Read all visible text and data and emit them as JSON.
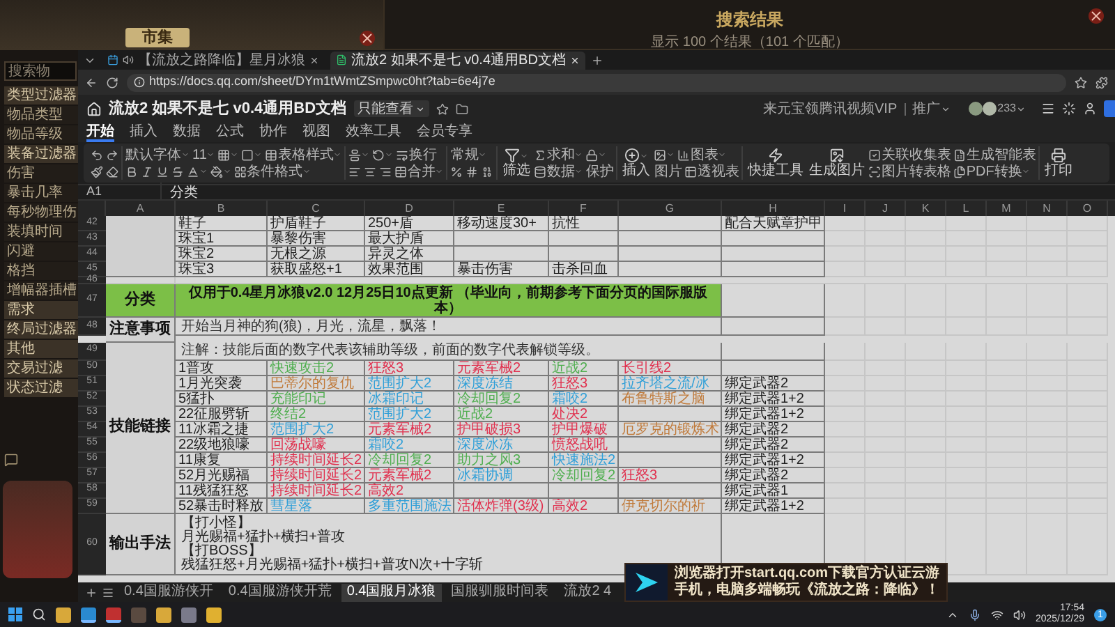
{
  "game": {
    "market": {
      "title": "市集"
    },
    "sidebar": {
      "search_placeholder": "搜索物",
      "filters": [
        {
          "label": "类型过滤器",
          "kind": "header"
        },
        {
          "label": "物品类型",
          "kind": "option"
        },
        {
          "label": "物品等级",
          "kind": "option"
        },
        {
          "label": "装备过滤器",
          "kind": "header"
        },
        {
          "label": "伤害",
          "kind": "option"
        },
        {
          "label": "暴击几率",
          "kind": "option"
        },
        {
          "label": "每秒物理伤",
          "kind": "option"
        },
        {
          "label": "装填时间",
          "kind": "option"
        },
        {
          "label": "闪避",
          "kind": "option"
        },
        {
          "label": "格挡",
          "kind": "option"
        },
        {
          "label": "增幅器插槽",
          "kind": "option"
        },
        {
          "label": "需求",
          "kind": "header"
        },
        {
          "label": "终局过滤器",
          "kind": "header"
        },
        {
          "label": "其他",
          "kind": "header"
        },
        {
          "label": "交易过滤",
          "kind": "header"
        },
        {
          "label": "状态过滤",
          "kind": "header"
        }
      ]
    },
    "results": {
      "title": "搜索结果",
      "summary": "显示 100 个结果（101 个匹配）"
    }
  },
  "browser": {
    "tabs": [
      {
        "label": "【流放之路降临】星月冰狼",
        "selected": false
      },
      {
        "label": "流放2 如果不是七 v0.4通用BD文档",
        "selected": true
      }
    ],
    "url": "https://docs.qq.com/sheet/DYm1tWmtZSmpwc0ht?tab=6e4j7e"
  },
  "doc": {
    "title": "流放2 如果不是七 v0.4通用BD文档",
    "mode": "只能查看",
    "promo": "来元宝领腾讯视频VIP",
    "promote": "推广",
    "avatar_count": "233",
    "menu": [
      {
        "label": "开始",
        "selected": true
      },
      {
        "label": "插入",
        "selected": false
      },
      {
        "label": "数据",
        "selected": false
      },
      {
        "label": "公式",
        "selected": false
      },
      {
        "label": "协作",
        "selected": false
      },
      {
        "label": "视图",
        "selected": false
      },
      {
        "label": "效率工具",
        "selected": false
      },
      {
        "label": "会员专享",
        "selected": false
      }
    ],
    "toolbar": [
      {
        "top": [
          {
            "dropdown": false
          },
          {
            "dropdown": false
          }
        ],
        "bottom": [
          {
            "dropdown": false
          },
          {
            "dropdown": false
          }
        ]
      },
      {
        "top": [
          {
            "label": "默认字体",
            "dropdown": true
          },
          {
            "label": "11",
            "dropdown": true
          },
          {
            "dropdown": true
          },
          {
            "dropdown": true
          },
          {
            "label": "表格样式",
            "dropdown": true
          }
        ],
        "bottom": [
          {
            "dropdown": false
          },
          {
            "dropdown": false
          },
          {
            "dropdown": false
          },
          {
            "dropdown": false
          },
          {
            "dropdown": true
          },
          {
            "dropdown": true
          },
          {
            "label": "条件格式",
            "dropdown": true
          }
        ]
      },
      {
        "top": [
          {
            "dropdown": true
          },
          {
            "dropdown": true
          },
          {
            "label": "换行",
            "dropdown": false
          }
        ],
        "bottom": [
          {
            "dropdown": false
          },
          {
            "dropdown": false
          },
          {
            "dropdown": false
          },
          {
            "label": "合并",
            "dropdown": true
          }
        ]
      },
      {
        "top": [
          {
            "label": "常规",
            "dropdown": true
          }
        ],
        "bottom": [
          {
            "dropdown": false
          },
          {
            "dropdown": false
          },
          {
            "dropdown": false
          }
        ]
      },
      {
        "tall": [
          {
            "label": "筛选",
            "dropdown": true
          }
        ],
        "top": [
          {
            "label": "求和",
            "dropdown": true
          },
          {
            "dropdown": true
          }
        ],
        "bottom": [
          {
            "label": "数据",
            "dropdown": true
          },
          {
            "label": "保护",
            "dropdown": false
          }
        ]
      },
      {
        "tall": [
          {
            "label": "插入",
            "dropdown": true
          }
        ],
        "top": [
          {
            "dropdown": true
          },
          {
            "label": "图表",
            "dropdown": true
          }
        ],
        "bottom": [
          {
            "label": "图片",
            "dropdown": false
          },
          {
            "label": "透视表",
            "dropdown": false
          }
        ]
      },
      {
        "tall": [
          {
            "label": "快捷工具",
            "dropdown": false
          },
          {
            "label": "生成图片",
            "dropdown": false
          }
        ],
        "top": [
          {
            "label": "关联收集表",
            "dropdown": false
          },
          {
            "label": "生成智能表",
            "dropdown": false
          }
        ],
        "bottom": [
          {
            "label": "图片转表格",
            "dropdown": false
          },
          {
            "label": "PDF转换",
            "dropdown": true
          }
        ]
      },
      {
        "tall": [
          {
            "label": "打印",
            "dropdown": false
          }
        ]
      }
    ],
    "cell_ref": "A1",
    "formula": "分类"
  },
  "sheet": {
    "columns": [
      "A",
      "B",
      "C",
      "D",
      "E",
      "F",
      "G",
      "H",
      "I",
      "J",
      "K",
      "L",
      "M",
      "N",
      "O"
    ],
    "blocks": [
      {
        "kind": "plain",
        "rows": [
          {
            "number": "42",
            "kind": "cells",
            "cells": [
              {
                "text": "鞋子"
              },
              {
                "text": "护盾鞋子"
              },
              {
                "text": "250+盾"
              },
              {
                "text": "移动速度30+"
              },
              {
                "text": "抗性"
              },
              {},
              {
                "text": "配合天赋章护甲"
              }
            ]
          },
          {
            "number": "43",
            "kind": "cells",
            "cells": [
              {
                "text": "珠宝1"
              },
              {
                "text": "暴黎伤害"
              },
              {
                "text": "最大护盾"
              },
              {},
              {},
              {},
              {}
            ]
          },
          {
            "number": "44",
            "kind": "cells",
            "cells": [
              {
                "text": "珠宝2"
              },
              {
                "text": "无根之源"
              },
              {
                "text": "异灵之体"
              },
              {},
              {},
              {},
              {}
            ]
          },
          {
            "number": "45",
            "kind": "cells",
            "cells": [
              {
                "text": "珠宝3"
              },
              {
                "text": "获取盛怒+1"
              },
              {
                "text": "效果范围"
              },
              {
                "text": "暴击伤害"
              },
              {
                "text": "击杀回血"
              },
              {},
              {}
            ]
          }
        ]
      },
      {
        "kind": "spacer",
        "rows": [
          {
            "number": "46",
            "kind": "blank"
          }
        ]
      },
      {
        "kind": "banner",
        "label": "分类",
        "rows": [
          {
            "number": "47",
            "kind": "merged",
            "text": "仅用于0.4星月冰狼v2.0  12月25日10点更新  （毕业向，前期参考下面分页的国际服版本）"
          }
        ]
      },
      {
        "kind": "plain",
        "label": "注意事项",
        "rows": [
          {
            "number": "48",
            "kind": "merged",
            "text": "开始当月神的狗(狼)，月光，流星，飘落！"
          }
        ]
      },
      {
        "kind": "plain",
        "label": "技能链接",
        "rows": [
          {
            "number": "49",
            "kind": "merged",
            "text": "注解：技能后面的数字代表该辅助等级，前面的数字代表解锁等级。"
          },
          {
            "number": "50",
            "kind": "cells",
            "cells": [
              {
                "text": "1普攻"
              },
              {
                "text": "快速攻击2",
                "color": "#4fae4f"
              },
              {
                "text": "狂怒3",
                "color": "#e0304e"
              },
              {
                "text": "元素军械2",
                "color": "#e0304e"
              },
              {
                "text": "近战2",
                "color": "#4fae4f"
              },
              {
                "text": "长引线2",
                "color": "#e0304e"
              },
              {}
            ]
          },
          {
            "number": "51",
            "kind": "cells",
            "cells": [
              {
                "text": "1月光突袭"
              },
              {
                "text": "巴蒂尔的复仇",
                "color": "#c07a3a"
              },
              {
                "text": "范围扩大2",
                "color": "#2f9fd8"
              },
              {
                "text": "深度冻结",
                "color": "#2f9fd8"
              },
              {
                "text": "狂怒3",
                "color": "#e0304e"
              },
              {
                "text": "拉齐塔之流/冰",
                "color": "#2f9fd8"
              },
              {
                "text": "绑定武器2"
              }
            ]
          },
          {
            "number": "52",
            "kind": "cells",
            "cells": [
              {
                "text": "5猛扑"
              },
              {
                "text": "充能印记",
                "color": "#4fae4f"
              },
              {
                "text": "冰霜印记",
                "color": "#2f9fd8"
              },
              {
                "text": "冷却回复2",
                "color": "#4fae4f"
              },
              {
                "text": "霜咬2",
                "color": "#2f9fd8"
              },
              {
                "text": "布鲁特斯之脑",
                "color": "#c07a3a"
              },
              {
                "text": "绑定武器1+2"
              }
            ]
          },
          {
            "number": "53",
            "kind": "cells",
            "cells": [
              {
                "text": "22征服劈斩"
              },
              {
                "text": "终结2",
                "color": "#4fae4f"
              },
              {
                "text": "范围扩大2",
                "color": "#2f9fd8"
              },
              {
                "text": "近战2",
                "color": "#4fae4f"
              },
              {
                "text": "处决2",
                "color": "#e0304e"
              },
              {},
              {
                "text": "绑定武器1+2"
              }
            ]
          },
          {
            "number": "54",
            "kind": "cells",
            "cells": [
              {
                "text": "11冰霜之捷"
              },
              {
                "text": "范围扩大2",
                "color": "#2f9fd8"
              },
              {
                "text": "元素军械2",
                "color": "#e0304e"
              },
              {
                "text": "护甲破损3",
                "color": "#e0304e"
              },
              {
                "text": "护甲爆破",
                "color": "#e0304e"
              },
              {
                "text": "厄罗克的锻炼术",
                "color": "#c07a3a"
              },
              {
                "text": "绑定武器2"
              }
            ]
          },
          {
            "number": "55",
            "kind": "cells",
            "cells": [
              {
                "text": "22级地狼嚎"
              },
              {
                "text": "回荡战嚎",
                "color": "#e0304e"
              },
              {
                "text": "霜咬2",
                "color": "#2f9fd8"
              },
              {
                "text": "深度冰冻",
                "color": "#2f9fd8"
              },
              {
                "text": "愤怒战吼",
                "color": "#e0304e"
              },
              {},
              {
                "text": "绑定武器2"
              }
            ]
          },
          {
            "number": "56",
            "kind": "cells",
            "cells": [
              {
                "text": "11康复"
              },
              {
                "text": "持续时间延长2",
                "color": "#e0304e"
              },
              {
                "text": "冷却回复2",
                "color": "#4fae4f"
              },
              {
                "text": "助力之风3",
                "color": "#4fae4f"
              },
              {
                "text": "快速施法2",
                "color": "#2f9fd8"
              },
              {},
              {
                "text": "绑定武器1+2"
              }
            ]
          },
          {
            "number": "57",
            "kind": "cells",
            "cells": [
              {
                "text": "52月光赐福"
              },
              {
                "text": "持续时间延长2",
                "color": "#e0304e"
              },
              {
                "text": "元素军械2",
                "color": "#e0304e"
              },
              {
                "text": "冰霜协调",
                "color": "#2f9fd8"
              },
              {
                "text": "冷却回复2",
                "color": "#4fae4f"
              },
              {
                "text": "狂怒3",
                "color": "#e0304e"
              },
              {
                "text": "绑定武器2"
              }
            ]
          },
          {
            "number": "58",
            "kind": "cells",
            "cells": [
              {
                "text": "11残猛狂怒"
              },
              {
                "text": "持续时间延长2",
                "color": "#e0304e"
              },
              {
                "text": "高效2",
                "color": "#e0304e"
              },
              {},
              {},
              {},
              {
                "text": "绑定武器1"
              }
            ]
          },
          {
            "number": "59",
            "kind": "cells",
            "cells": [
              {
                "text": "52暴击时释放"
              },
              {
                "text": "彗星落",
                "color": "#2f9fd8"
              },
              {
                "text": "多重范围施法",
                "color": "#2f9fd8"
              },
              {
                "text": "活体炸弹(3级)",
                "color": "#e0304e"
              },
              {
                "text": "高效2",
                "color": "#e0304e"
              },
              {
                "text": "伊克切尔的祈",
                "color": "#c07a3a"
              },
              {
                "text": "绑定武器1+2"
              }
            ]
          }
        ]
      },
      {
        "kind": "plain",
        "label": "输出手法",
        "rows": [
          {
            "number": "60",
            "kind": "lines",
            "lines": [
              "【打小怪】",
              "月光赐福+猛扑+横扫+普攻",
              "【打BOSS】",
              "残猛狂怒+月光赐福+猛扑+横扫+普攻N次+十字斩"
            ]
          }
        ]
      }
    ],
    "tabs": [
      {
        "label": "0.4国服游侠开",
        "selected": false
      },
      {
        "label": "0.4国服游侠开荒",
        "selected": false
      },
      {
        "label": "0.4国服月冰狼",
        "selected": true
      },
      {
        "label": "国服驯服时间表",
        "selected": false
      },
      {
        "label": "流放2 4",
        "selected": false
      }
    ]
  },
  "ad": {
    "lines": [
      "浏览器打开start.qq.com下载官方认证云游",
      "手机，电脑多端畅玩《流放之路：降临》！"
    ]
  },
  "taskbar": {
    "apps": [
      {
        "selected": false
      },
      {
        "selected": true
      },
      {
        "selected": true
      },
      {
        "selected": false
      },
      {
        "selected": false
      },
      {
        "selected": false
      },
      {
        "selected": false
      }
    ],
    "time": "17:54",
    "date": "2025/12/29",
    "badge": "1"
  }
}
